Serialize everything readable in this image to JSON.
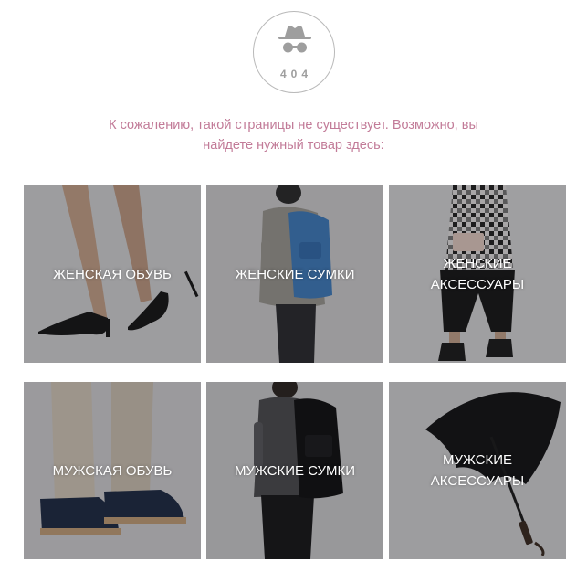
{
  "error": {
    "code": "404",
    "icon": "incognito-hat-glasses-icon",
    "message": "К сожалению, такой страницы не существует. Возможно, вы найдете нужный товар здесь:"
  },
  "categories": [
    {
      "label": "ЖЕНСКАЯ ОБУВЬ",
      "image": "black-stiletto-heels"
    },
    {
      "label": "ЖЕНСКИЕ СУМКИ",
      "image": "woman-blue-backpack"
    },
    {
      "label": "ЖЕНСКИЕ АКСЕССУАРЫ",
      "image": "woman-plaid-shirt-clutch"
    },
    {
      "label": "МУЖСКАЯ ОБУВЬ",
      "image": "men-navy-sneakers"
    },
    {
      "label": "МУЖСКИЕ СУМКИ",
      "image": "man-black-backpack"
    },
    {
      "label": "МУЖСКИЕ АКСЕССУАРЫ",
      "image": "black-umbrella"
    }
  ],
  "colors": {
    "accent": "#c27b98",
    "icon": "#9e9e9e",
    "tile_bg": "#a9a8aa"
  }
}
